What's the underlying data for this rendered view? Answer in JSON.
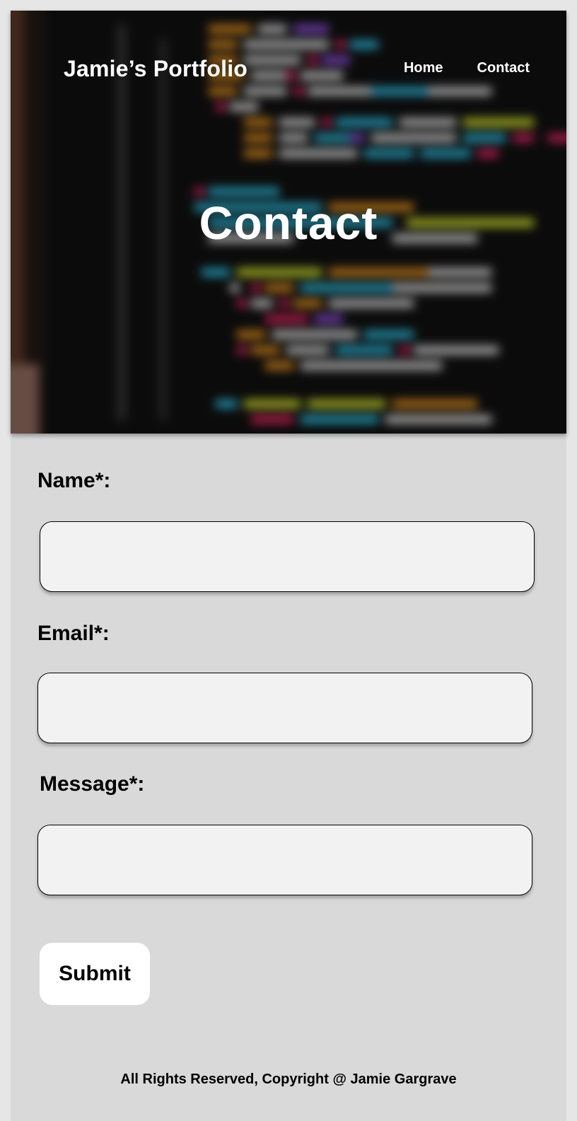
{
  "header": {
    "site_title": "Jamie’s Portfolio",
    "nav": [
      {
        "label": "Home"
      },
      {
        "label": "Contact"
      }
    ]
  },
  "hero": {
    "heading": "Contact"
  },
  "form": {
    "name_label": "Name*:",
    "name_value": "",
    "email_label": "Email*:",
    "email_value": "",
    "message_label": "Message*:",
    "message_value": "",
    "submit_label": "Submit"
  },
  "footer": {
    "copyright": "All Rights Reserved, Copyright @ Jamie Gargrave"
  },
  "colors": {
    "page_background": "#d9d9d9",
    "outer_background": "#e6e6e6",
    "input_background": "#f2f2f2",
    "button_background": "#ffffff",
    "hero_text": "#ffffff"
  }
}
